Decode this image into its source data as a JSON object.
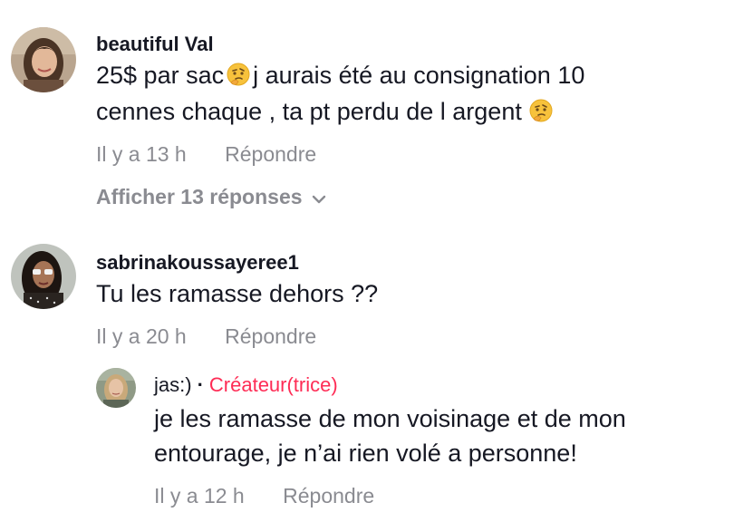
{
  "comments": [
    {
      "username": "beautiful Val",
      "text_line1_a": "25$ par sac",
      "text_line1_b": "j aurais été au consignation 10",
      "text_line2": "cennes chaque , ta pt perdu de l argent",
      "emoji": "thinking-face",
      "time": "Il y a 13 h",
      "reply_label": "Répondre",
      "view_replies_label": "Afficher 13 réponses"
    },
    {
      "username": "sabrinakoussayeree1",
      "text": "Tu les ramasse dehors ??",
      "time": "Il y a 20 h",
      "reply_label": "Répondre"
    }
  ],
  "reply": {
    "username": "jas:)",
    "separator": "·",
    "creator_label": "Créateur(trice)",
    "creator_color": "#fe2c55",
    "text_line1": "je les ramasse de mon voisinage et de mon",
    "text_line2": "entourage, je n’ai rien volé a personne!",
    "time": "Il y a 12 h",
    "reply_label": "Répondre"
  },
  "colors": {
    "text": "#161823",
    "muted": "#8a8b91",
    "accent": "#fe2c55"
  }
}
